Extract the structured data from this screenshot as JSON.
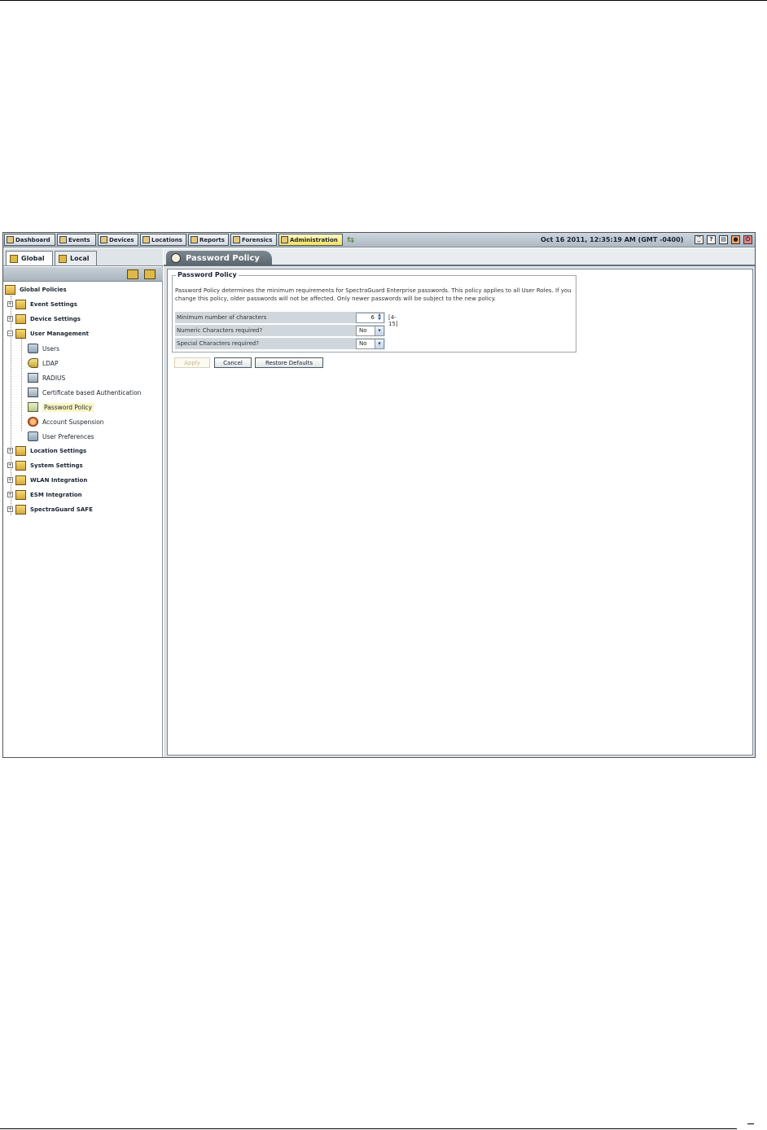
{
  "toolbar": {
    "nav": [
      {
        "label": "Dashboard",
        "icon": "dashboard-icon"
      },
      {
        "label": "Events",
        "icon": "events-icon"
      },
      {
        "label": "Devices",
        "icon": "devices-icon"
      },
      {
        "label": "Locations",
        "icon": "locations-icon"
      },
      {
        "label": "Reports",
        "icon": "reports-icon"
      },
      {
        "label": "Forensics",
        "icon": "forensics-icon"
      },
      {
        "label": "Administration",
        "icon": "administration-icon",
        "active": true
      }
    ],
    "datetime": "Oct 16 2011, 12:35:19 AM (GMT -0400)",
    "tools": [
      "clock-icon",
      "help-icon",
      "window-icon",
      "settings-icon",
      "logout-icon"
    ]
  },
  "left": {
    "tabs": {
      "global": "Global",
      "local": "Local"
    },
    "tree": {
      "root": "Global Policies",
      "event_settings": "Event Settings",
      "device_settings": "Device Settings",
      "user_management": "User Management",
      "users": "Users",
      "ldap": "LDAP",
      "radius": "RADIUS",
      "cert_auth": "Certificate based Authentication",
      "password_policy": "Password Policy",
      "account_suspension": "Account Suspension",
      "user_preferences": "User Preferences",
      "location_settings": "Location Settings",
      "system_settings": "System Settings",
      "wlan_integration": "WLAN Integration",
      "esm_integration": "ESM Integration",
      "spectraguard_safe": "SpectraGuard SAFE"
    }
  },
  "main": {
    "tab_title": "Password Policy",
    "fieldset": {
      "legend": "Password Policy",
      "description": "Password Policy determines the minimum requirements for SpectraGuard Enterprise passwords. This policy applies to all User Roles. If you change this policy, older passwords will not be affected. Only newer passwords will be subject to the new policy.",
      "fields": {
        "min_chars": {
          "label": "Minimum number of characters",
          "value": "6",
          "range": "[4-15]"
        },
        "numeric": {
          "label": "Numeric Characters required?",
          "value": "No"
        },
        "special": {
          "label": "Special Characters required?",
          "value": "No"
        }
      }
    },
    "buttons": {
      "apply": "Apply",
      "cancel": "Cancel",
      "restore": "Restore Defaults"
    }
  },
  "colors": {
    "active_tab": "#f4e15c",
    "selected_node": "#fbf6c4",
    "tab_header": "#5a656e"
  }
}
